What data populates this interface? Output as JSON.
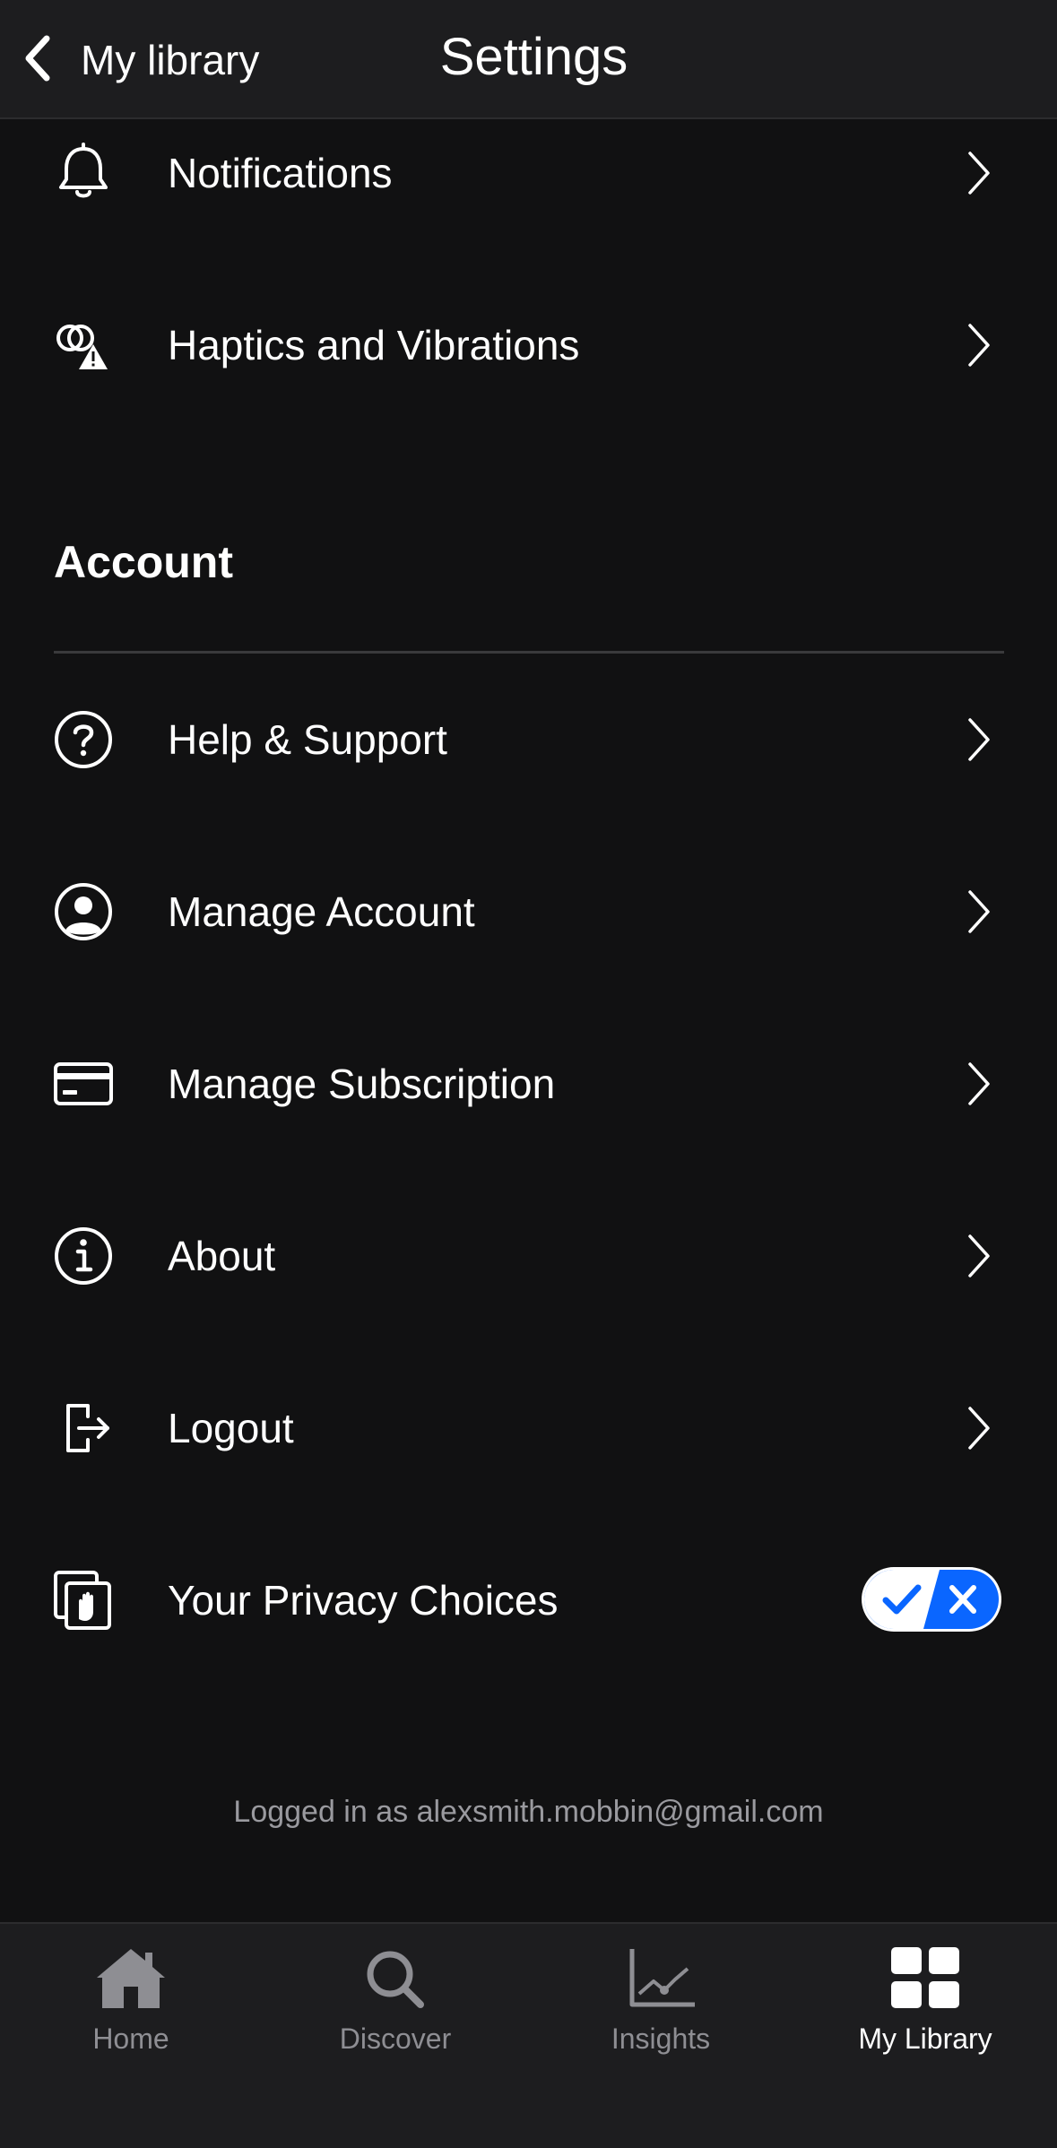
{
  "header": {
    "back_label": "My library",
    "title": "Settings"
  },
  "rows_top": [
    {
      "label": "Notifications",
      "icon": "bell-icon"
    },
    {
      "label": "Haptics and Vibrations",
      "icon": "haptics-warning-icon"
    }
  ],
  "account": {
    "section_title": "Account",
    "rows": [
      {
        "label": "Help & Support",
        "icon": "help-circle-icon"
      },
      {
        "label": "Manage Account",
        "icon": "user-circle-icon"
      },
      {
        "label": "Manage Subscription",
        "icon": "credit-card-icon"
      },
      {
        "label": "About",
        "icon": "info-circle-icon"
      },
      {
        "label": "Logout",
        "icon": "logout-icon"
      },
      {
        "label": "Your Privacy Choices",
        "icon": "privacy-hand-icon"
      }
    ]
  },
  "privacy_toggle": {
    "icon": "privacy-options-toggle-icon",
    "color": "#0a66ff"
  },
  "logged_in_text": "Logged in as alexsmith.mobbin@gmail.com",
  "tabbar": {
    "tabs": [
      {
        "label": "Home",
        "icon": "home-icon",
        "active": false
      },
      {
        "label": "Discover",
        "icon": "search-icon",
        "active": false
      },
      {
        "label": "Insights",
        "icon": "chart-line-icon",
        "active": false
      },
      {
        "label": "My Library",
        "icon": "grid-icon",
        "active": true
      }
    ]
  },
  "colors": {
    "background": "#111112",
    "bar": "#1d1d1f",
    "text": "#ffffff",
    "muted": "#8e8e93",
    "accent": "#0a66ff"
  }
}
